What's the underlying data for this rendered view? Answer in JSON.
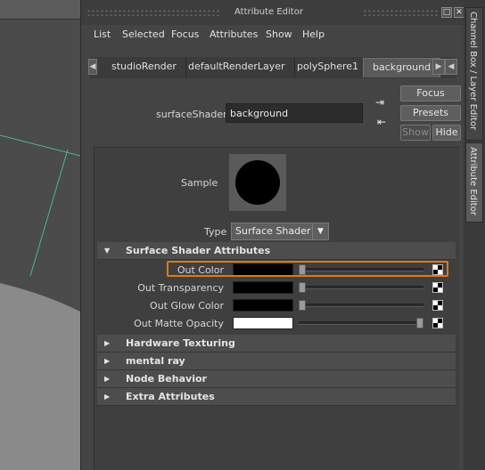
{
  "window": {
    "title": "Attribute Editor",
    "controls": {
      "float": "□",
      "close": "✕"
    }
  },
  "menu": [
    "List",
    "Selected",
    "Focus",
    "Attributes",
    "Show",
    "Help"
  ],
  "tabs": {
    "items": [
      "studioRender",
      "defaultRenderLayer",
      "polySphere1",
      "background"
    ],
    "active": "background"
  },
  "node": {
    "label": "surfaceShader:",
    "value": "background"
  },
  "buttons": {
    "focus": "Focus",
    "presets": "Presets",
    "show": "Show",
    "hide": "Hide"
  },
  "sample": {
    "label": "Sample"
  },
  "type": {
    "label": "Type",
    "value": "Surface Shader"
  },
  "sections": {
    "surface_shader": "Surface Shader Attributes",
    "hardware_texturing": "Hardware Texturing",
    "mental_ray": "mental ray",
    "node_behavior": "Node Behavior",
    "extra_attributes": "Extra Attributes"
  },
  "attributes": [
    {
      "label": "Out Color",
      "color": "#000000",
      "slider": 0.0
    },
    {
      "label": "Out Transparency",
      "color": "#000000",
      "slider": 0.0
    },
    {
      "label": "Out Glow Color",
      "color": "#000000",
      "slider": 0.0
    },
    {
      "label": "Out Matte Opacity",
      "color": "#ffffff",
      "slider": 1.0
    }
  ],
  "dock_tabs": [
    "Channel Box / Layer Editor",
    "Attribute Editor"
  ],
  "colors": {
    "highlight": "#e07a12",
    "viewport_lines": "#4fb3a0"
  }
}
